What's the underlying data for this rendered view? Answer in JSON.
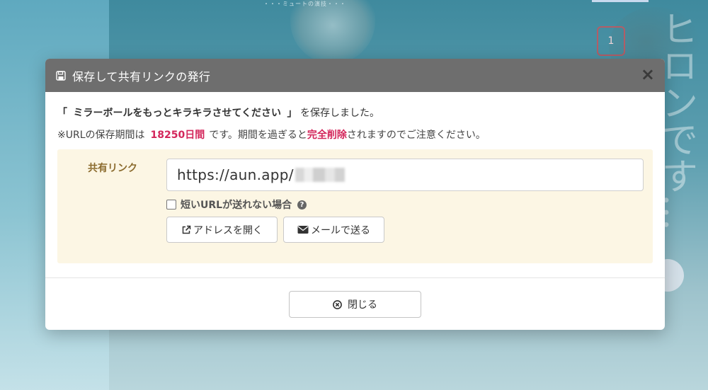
{
  "background": {
    "caption": "・・・ミュートの演技・・・",
    "badge_number": "1",
    "vertical_text": "ヒロンです…"
  },
  "dialog": {
    "title": "保存して共有リンクの発行",
    "close_symbol": "×",
    "saved_message": {
      "quote_open": "「",
      "title": "ミラーボールをもっとキラキラさせてください",
      "quote_close": "」",
      "suffix": "を保存しました。"
    },
    "retention_message": {
      "prefix": "※URLの保存期間は",
      "days": "18250日間",
      "middle": "です。期間を過ぎると",
      "deletion": "完全削除",
      "suffix": "されますのでご注意ください。"
    },
    "share": {
      "label": "共有リンク",
      "url_visible": "https://aun.app/",
      "short_url_checkbox_label": "短いURLが送れない場合",
      "short_url_checked": false,
      "help_symbol": "?",
      "open_button_label": "アドレスを開く",
      "mail_button_label": "メールで送る"
    },
    "close_button_label": "閉じる"
  },
  "colors": {
    "header_bg": "#6e6e6e",
    "accent_red": "#d3265b",
    "share_box_bg": "#fcf6e4",
    "share_label": "#8a6a2d"
  },
  "icons": {
    "header": "floppy-disk-icon",
    "open": "external-link-icon",
    "mail": "envelope-icon",
    "close": "circle-x-icon",
    "help": "question-circle-icon"
  }
}
